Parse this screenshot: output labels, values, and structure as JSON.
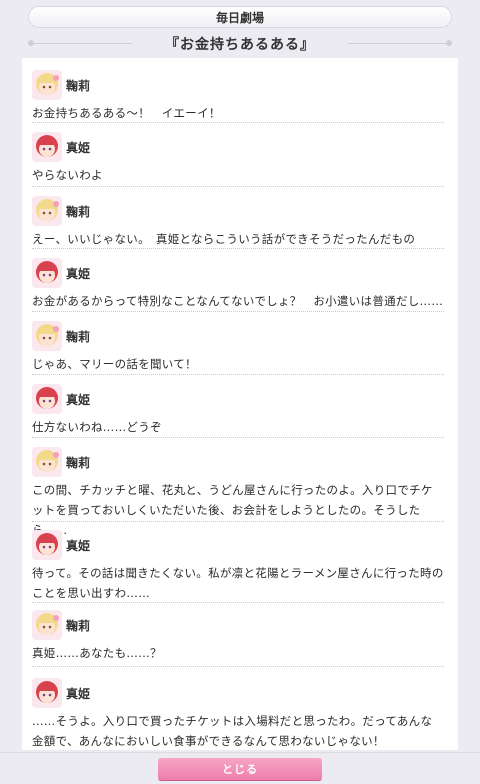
{
  "header": {
    "label": "毎日劇場"
  },
  "episode_title": "『お金持ちあるある』",
  "dialogues": [
    {
      "speaker": "鞠莉",
      "avatar": "mari-avatar",
      "text": "お金持ちあるある～！　イエーイ！"
    },
    {
      "speaker": "真姫",
      "avatar": "maki-avatar",
      "text": "やらないわよ"
    },
    {
      "speaker": "鞠莉",
      "avatar": "mari-avatar",
      "text": "えー、いいじゃない。　真姫とならこういう話ができそうだったんだもの"
    },
    {
      "speaker": "真姫",
      "avatar": "maki-avatar",
      "text": "お金があるからって特別なことなんてないでしょ？　お小遣いは普通だし……"
    },
    {
      "speaker": "鞠莉",
      "avatar": "mari-avatar",
      "text": "じゃあ、マリーの話を聞いて！"
    },
    {
      "speaker": "真姫",
      "avatar": "maki-avatar",
      "text": "仕方ないわね……どうぞ"
    },
    {
      "speaker": "鞠莉",
      "avatar": "mari-avatar",
      "text": "この間、チカッチと曜、花丸と、うどん屋さんに行ったのよ。入り口でチケットを買っておいしくいただいた後、お会計をしようとしたの。そうしたら……"
    },
    {
      "speaker": "真姫",
      "avatar": "maki-avatar",
      "text": "待って。その話は聞きたくない。私が凛と花陽とラーメン屋さんに行った時のことを思い出すわ……"
    },
    {
      "speaker": "鞠莉",
      "avatar": "mari-avatar",
      "text": "真姫……あなたも……？"
    },
    {
      "speaker": "真姫",
      "avatar": "maki-avatar",
      "text": "……そうよ。入り口で買ったチケットは入場料だと思ったわ。だってあんな金額で、あんなにおいしい食事ができるなんて思わないじゃない！"
    }
  ],
  "close_button": {
    "label": "とじる"
  },
  "colors": {
    "background": "#ecebf1",
    "accent_pink": "#ee7fab",
    "mari_hair": "#f3d98a",
    "maki_hair": "#d8424e"
  }
}
